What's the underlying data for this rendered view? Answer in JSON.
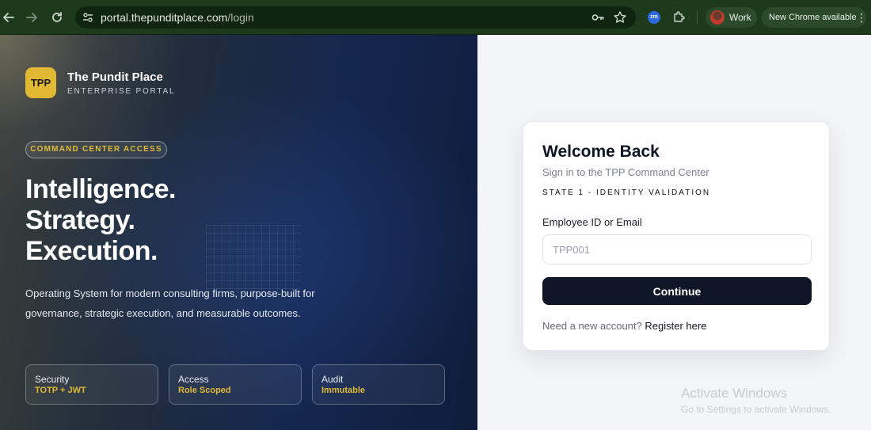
{
  "browser": {
    "url_host": "portal.thepunditplace.com",
    "url_path": "/login",
    "extension_label": "zm",
    "profile_name": "Work",
    "update_label": "New Chrome available"
  },
  "brand": {
    "logo_text": "TPP",
    "name": "The Pundit Place",
    "subtitle": "ENTERPRISE PORTAL",
    "accent_color": "#e2b935"
  },
  "hero": {
    "pill": "COMMAND CENTER ACCESS",
    "headline": [
      "Intelligence.",
      "Strategy.",
      "Execution."
    ],
    "description": "Operating System for modern consulting firms, purpose-built for governance, strategic execution, and measurable outcomes.",
    "stats": [
      {
        "title": "Security",
        "value": "TOTP + JWT"
      },
      {
        "title": "Access",
        "value": "Role Scoped"
      },
      {
        "title": "Audit",
        "value": "Immutable"
      }
    ]
  },
  "login": {
    "title": "Welcome Back",
    "subtitle": "Sign in to the TPP Command Center",
    "state": "STATE 1 - IDENTITY VALIDATION",
    "field_label": "Employee ID or Email",
    "field_placeholder": "TPP001",
    "field_value": "",
    "button": "Continue",
    "register_prompt": "Need a new account?",
    "register_link": "Register here",
    "button_color": "#0f1628"
  },
  "watermark": {
    "line1": "Activate Windows",
    "line2": "Go to Settings to activate Windows."
  }
}
